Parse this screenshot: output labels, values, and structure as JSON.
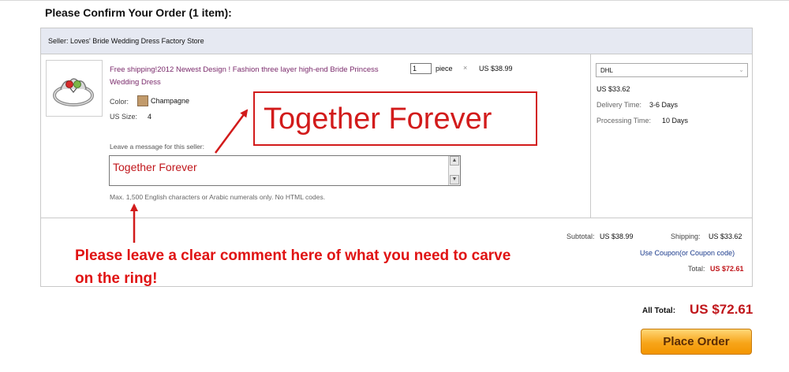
{
  "page": {
    "title": "Please Confirm Your Order (1 item):"
  },
  "seller": {
    "label": "Seller: Loves' Bride Wedding Dress Factory Store"
  },
  "product": {
    "title": "Free shipping!2012 Newest Design ! Fashion three layer high-end Bride Princess Wedding Dress",
    "quantity": "1",
    "unit": "piece",
    "times": "×",
    "unit_price": "US $38.99",
    "color_label": "Color:",
    "color_value": "Champagne",
    "size_label": "US Size:",
    "size_value": "4",
    "swatch_color": "#c19a6b"
  },
  "message": {
    "label": "Leave a message for this seller:",
    "text": "Together Forever",
    "hint": "Max. 1,500 English characters or Arabic numerals only. No HTML codes."
  },
  "shipping": {
    "method": "DHL",
    "cost": "US $33.62",
    "delivery_label": "Delivery Time:",
    "delivery_value": "3-6 Days",
    "processing_label": "Processing Time:",
    "processing_value": "10 Days"
  },
  "summary": {
    "subtotal_label": "Subtotal:",
    "subtotal_value": "US $38.99",
    "shipping_label": "Shipping:",
    "shipping_value": "US $33.62",
    "coupon_link": "Use Coupon(or Coupon code)",
    "total_label": "Total:",
    "total_value": "US $72.61"
  },
  "annotation": {
    "callout": "Together Forever",
    "instruction": "Please leave a clear comment here of what you need to carve on the ring!",
    "color": "#e01313"
  },
  "footer": {
    "all_total_label": "All Total:",
    "all_total_value": "US $72.61",
    "place_order_label": "Place Order"
  },
  "icons": {
    "scroll_up": "▲",
    "scroll_down": "▼",
    "dropdown": "⌄"
  }
}
